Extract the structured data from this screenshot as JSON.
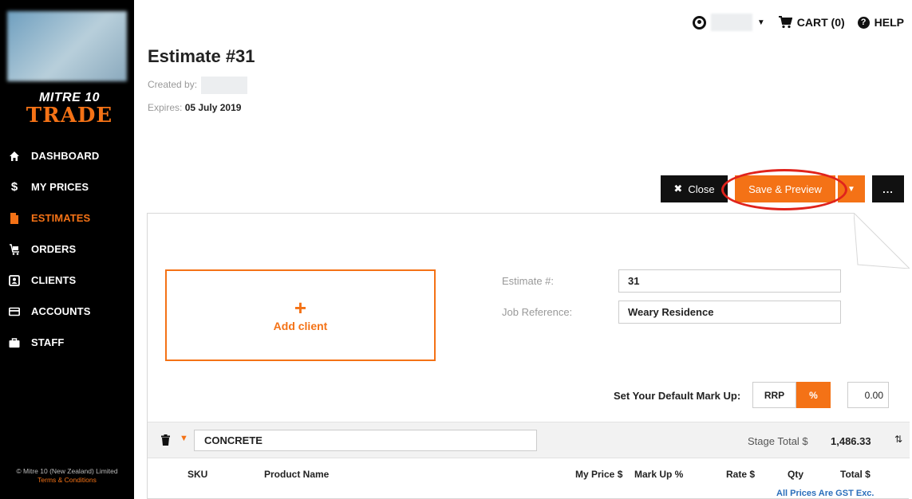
{
  "sidebar": {
    "logo_line1": "MITRE 10",
    "logo_line2": "TRADE",
    "items": [
      {
        "label": "DASHBOARD",
        "icon": "home-icon"
      },
      {
        "label": "MY PRICES",
        "icon": "dollar-icon"
      },
      {
        "label": "ESTIMATES",
        "icon": "document-icon",
        "active": true
      },
      {
        "label": "ORDERS",
        "icon": "trolley-icon"
      },
      {
        "label": "CLIENTS",
        "icon": "contact-icon"
      },
      {
        "label": "ACCOUNTS",
        "icon": "card-icon"
      },
      {
        "label": "STAFF",
        "icon": "briefcase-icon"
      }
    ],
    "copyright": "© Mitre 10 (New Zealand) Limited",
    "terms": "Terms & Conditions"
  },
  "topbar": {
    "cart_label": "CART (0)",
    "help_label": "HELP"
  },
  "header": {
    "title": "Estimate #31",
    "created_label": "Created by:",
    "expires_label": "Expires:",
    "expires_value": "05 July 2019"
  },
  "actions": {
    "close_label": "Close",
    "save_label": "Save & Preview",
    "more_label": "..."
  },
  "client": {
    "plus": "+",
    "add_label": "Add client"
  },
  "form": {
    "estimate_label": "Estimate #:",
    "estimate_value": "31",
    "job_label": "Job Reference:",
    "job_value": "Weary Residence"
  },
  "markup": {
    "label": "Set Your Default Mark Up:",
    "rrp": "RRP",
    "percent": "%",
    "value": "0.00"
  },
  "stage": {
    "name": "CONCRETE",
    "total_label": "Stage Total $",
    "total_value": "1,486.33"
  },
  "table": {
    "columns": [
      "SKU",
      "Product Name",
      "My Price $",
      "Mark Up %",
      "Rate $",
      "Qty",
      "Total $"
    ],
    "gst_note": "All Prices Are GST Exc."
  },
  "colors": {
    "accent": "#f47216",
    "sidebar_bg": "#000000",
    "highlight": "#e0231c",
    "link": "#2a6ebb"
  }
}
